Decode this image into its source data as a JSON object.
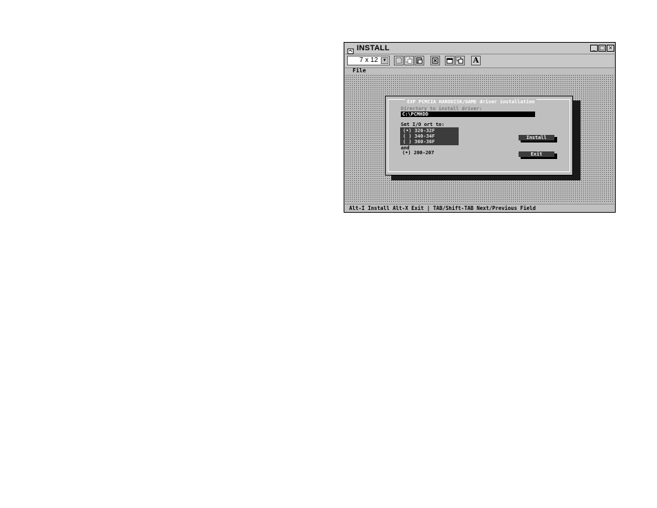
{
  "window": {
    "title": "INSTALL",
    "controls": {
      "minimize": "_",
      "maximize": "□",
      "close": "×"
    }
  },
  "toolbar": {
    "font_size": "7 x 12",
    "dropdown_arrow": "▼",
    "bold_font_label": "A"
  },
  "menubar": {
    "file_label": "File"
  },
  "dialog": {
    "title": "EXP PCMCIA HARDDISK/GAME driver installation",
    "directory_label": "Directory to install driver:",
    "directory_value": "C:\\PCMHDD",
    "port_label": "Set I/O  ort to:",
    "port_options": [
      {
        "label": "(•) 320-32F"
      },
      {
        "label": "( ) 340-34F"
      },
      {
        "label": "( ) 360-36F"
      }
    ],
    "and_label": "and",
    "game_port_option": "(•) 200-207",
    "install_button": "Install",
    "exit_button": "Exit"
  },
  "statusbar": {
    "text": "Alt-I Install  Alt-X Exit | TAB/Shift-TAB Next/Previous Field"
  }
}
